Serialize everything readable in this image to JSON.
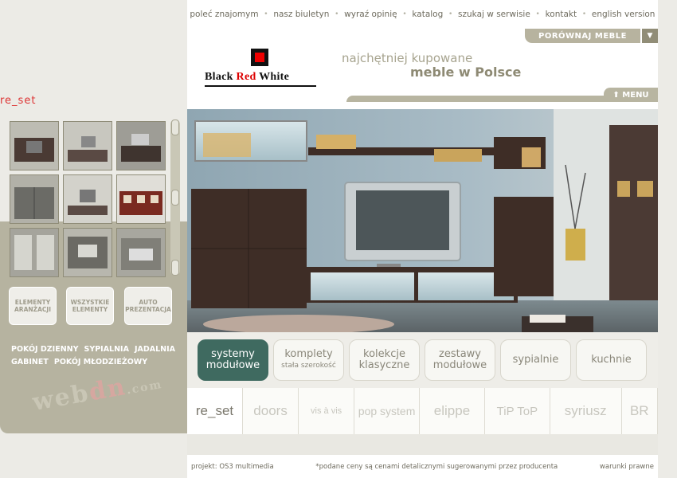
{
  "nav": {
    "items": [
      "poleć znajomym",
      "nasz biuletyn",
      "wyraź opinię",
      "katalog",
      "szukaj w serwisie",
      "kontakt",
      "english version"
    ]
  },
  "header": {
    "compare_label": "PORÓWNAJ MEBLE",
    "compare_arrow": "▼",
    "logo_text": {
      "part1": "Black ",
      "part2": "Red",
      "part3": " White"
    },
    "slogan_line1": "najchętniej kupowane",
    "slogan_line2": "meble w Polsce",
    "menu_label": "⬆ MENU"
  },
  "left": {
    "title": "re_set",
    "buttons": [
      {
        "l1": "ELEMENTY",
        "l2": "ARANŻACJI"
      },
      {
        "l1": "WSZYSTKIE",
        "l2": "ELEMENTY"
      },
      {
        "l1": "AUTO",
        "l2": "PREZENTACJA"
      }
    ],
    "rooms": [
      "POKÓJ DZIENNY",
      "SYPIALNIA",
      "JADALNIA",
      "GABINET",
      "POKÓJ MŁODZIEŻOWY"
    ],
    "watermark": {
      "p1": "web",
      "p2": "dn",
      "p3": ".com"
    }
  },
  "categories": [
    {
      "l1": "systemy",
      "l2": "modułowe",
      "active": true
    },
    {
      "l1": "komplety",
      "l2": "stała szerokość",
      "small": true
    },
    {
      "l1": "kolekcje",
      "l2": "klasyczne"
    },
    {
      "l1": "zestawy",
      "l2": "modułowe"
    },
    {
      "l1": "sypialnie",
      "l2": ""
    },
    {
      "l1": "kuchnie",
      "l2": ""
    }
  ],
  "brands": [
    "re_set",
    "doors",
    "vis à vis",
    "pop system",
    "elippe",
    "TiP ToP",
    "syriusz",
    "BR"
  ],
  "footer": {
    "left": "projekt: OS3 multimedia",
    "middle": "*podane ceny są cenami detalicznymi sugerowanymi przez producenta",
    "right": "warunki prawne"
  },
  "colors": {
    "accent": "#3f6a60",
    "panel": "#b6b3a0",
    "logo_red": "#dd0000"
  }
}
